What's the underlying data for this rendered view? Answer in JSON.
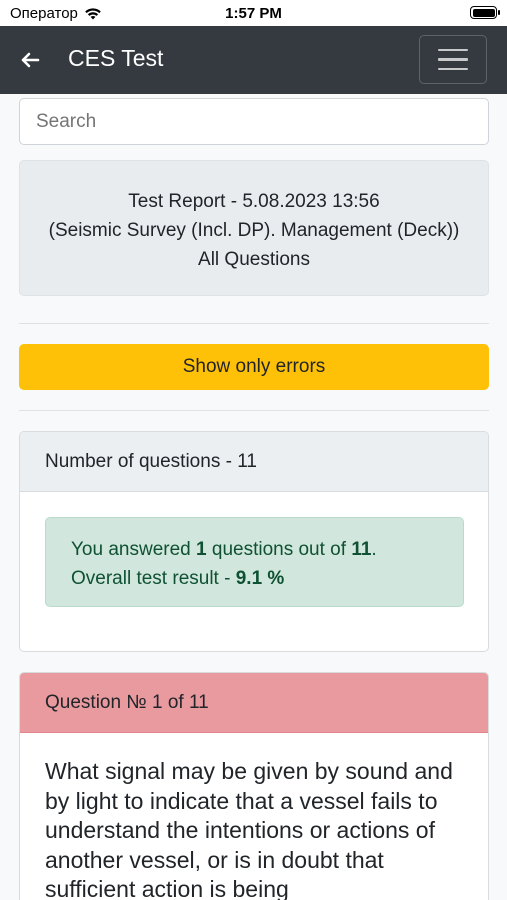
{
  "status_bar": {
    "carrier": "Оператор",
    "time": "1:57 PM"
  },
  "navbar": {
    "title": "CES Test"
  },
  "search": {
    "placeholder": "Search"
  },
  "report": {
    "line1": "Test Report - 5.08.2023 13:56",
    "line2": "(Seismic Survey (Incl. DP). Management (Deck))",
    "line3": "All Questions"
  },
  "filter_button": {
    "label": "Show only errors"
  },
  "summary": {
    "header": "Number of questions - 11",
    "answered_prefix": "You answered ",
    "answered_count": "1",
    "answered_middle": " questions out of ",
    "total_count": "11",
    "answered_suffix": ".",
    "result_prefix": "Overall test result - ",
    "result_value": "9.1 %"
  },
  "question": {
    "header": "Question № 1 of 11",
    "text": "What signal may be given by sound and by light to indicate that a vessel fails to understand the intentions or actions of another vessel, or is in doubt that sufficient action is being"
  },
  "colors": {
    "navbar": "#343a40",
    "warning": "#ffc107",
    "success_bg": "#d1e7dd",
    "success_text": "#0f5132",
    "danger_header": "#e99a9f"
  }
}
